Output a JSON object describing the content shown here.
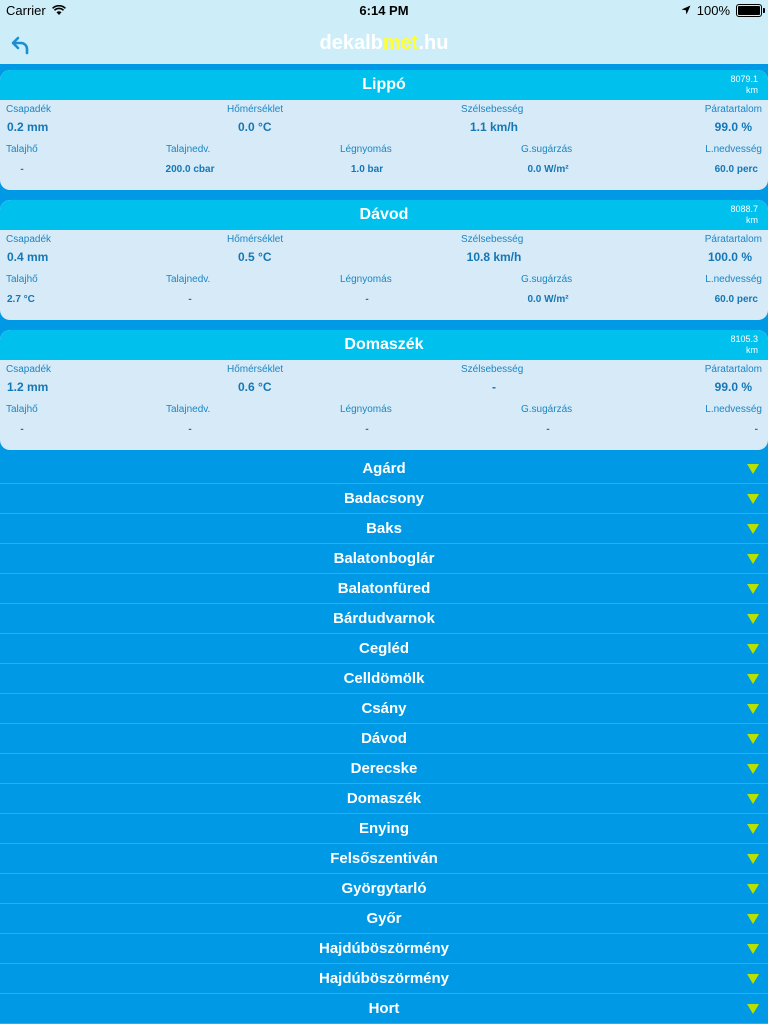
{
  "status": {
    "carrier": "Carrier",
    "time": "6:14 PM",
    "battery": "100%"
  },
  "nav": {
    "logo_a": "dekalb",
    "logo_b": "met",
    "logo_c": ".hu"
  },
  "labels": {
    "csapadek": "Csapadék",
    "homerseklet": "Hőmérséklet",
    "szelsebesseg": "Szélsebesség",
    "paratartalom": "Páratartalom",
    "talajho": "Talajhő",
    "talajnedv": "Talajnedv.",
    "legnyomas": "Légnyomás",
    "gsugarzas": "G.sugárzás",
    "lnedvesseg": "L.nedvesség"
  },
  "stations": [
    {
      "name": "Lippó",
      "dist": "8079.1",
      "unit": "km",
      "csapadek": "0.2 mm",
      "homerseklet": "0.0 °C",
      "szelsebesseg": "1.1 km/h",
      "paratartalom": "99.0 %",
      "talajho": "-",
      "talajnedv": "200.0 cbar",
      "legnyomas": "1.0 bar",
      "gsugarzas": "0.0 W/m²",
      "lnedvesseg": "60.0 perc"
    },
    {
      "name": "Dávod",
      "dist": "8088.7",
      "unit": "km",
      "csapadek": "0.4 mm",
      "homerseklet": "0.5 °C",
      "szelsebesseg": "10.8 km/h",
      "paratartalom": "100.0 %",
      "talajho": "2.7 °C",
      "talajnedv": "-",
      "legnyomas": "-",
      "gsugarzas": "0.0 W/m²",
      "lnedvesseg": "60.0 perc"
    },
    {
      "name": "Domaszék",
      "dist": "8105.3",
      "unit": "km",
      "csapadek": "1.2 mm",
      "homerseklet": "0.6 °C",
      "szelsebesseg": "-",
      "paratartalom": "99.0 %",
      "talajho": "-",
      "talajnedv": "-",
      "legnyomas": "-",
      "gsugarzas": "-",
      "lnedvesseg": "-"
    }
  ],
  "list": [
    "Agárd",
    "Badacsony",
    "Baks",
    "Balatonboglár",
    "Balatonfüred",
    "Bárdudvarnok",
    "Cegléd",
    "Celldömölk",
    "Csány",
    "Dávod",
    "Derecske",
    "Domaszék",
    "Enying",
    "Felsőszentiván",
    "Györgytarló",
    "Győr",
    "Hajdúböszörmény",
    "Hajdúböszörmény",
    "Hort"
  ],
  "colors": {
    "accent": "#0099e6",
    "header": "#00c0ee",
    "card": "#d6eaf7",
    "arrow": "#b8e000"
  }
}
